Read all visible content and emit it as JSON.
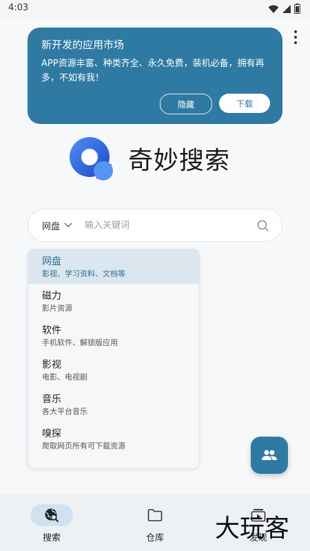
{
  "status_bar": {
    "time": "4:03"
  },
  "banner": {
    "title": "新开发的应用市场",
    "text": "APP资源丰富、种类齐全、永久免费，装机必备，拥有再多，不如有我！",
    "hide_label": "隐藏",
    "download_label": "下载"
  },
  "logo": {
    "text": "奇妙搜索"
  },
  "search": {
    "type": "网盘",
    "placeholder": "输入关键词"
  },
  "dropdown": {
    "items": [
      {
        "title": "网盘",
        "desc": "影视、学习资料、文档等"
      },
      {
        "title": "磁力",
        "desc": "影片资源"
      },
      {
        "title": "软件",
        "desc": "手机软件、解锁版应用"
      },
      {
        "title": "影视",
        "desc": "电影、电视剧"
      },
      {
        "title": "音乐",
        "desc": "各大平台音乐"
      },
      {
        "title": "嗅探",
        "desc": "爬取网页所有可下载资源"
      }
    ]
  },
  "nav": {
    "search_label": "搜索",
    "warehouse_label": "仓库",
    "third_label": "发现"
  },
  "watermark": "大玩客",
  "colors": {
    "accent": "#2f7aa3",
    "selected_bg": "#dce6ef"
  }
}
